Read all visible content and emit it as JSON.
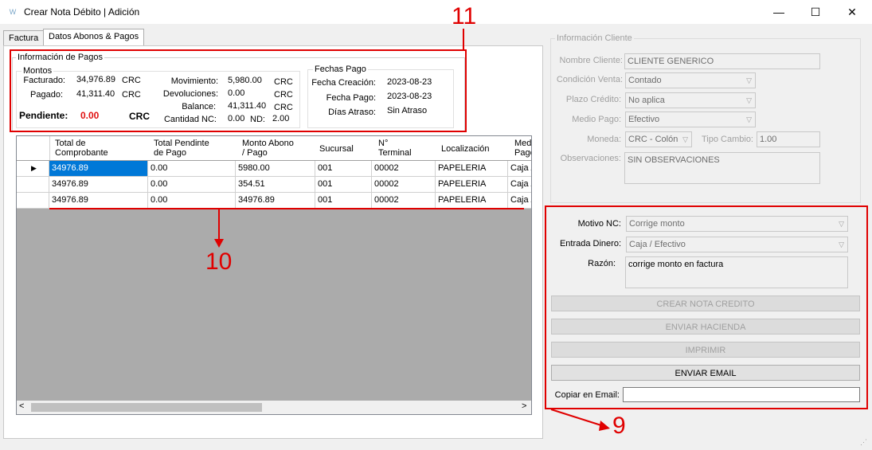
{
  "window": {
    "title": "Crear Nota Débito | Adición",
    "app_icon": "W",
    "minimize": "—",
    "maximize": "☐",
    "close": "✕"
  },
  "tabs": [
    "Factura",
    "Datos Abonos & Pagos"
  ],
  "info_pagos": {
    "title": "Información de Pagos",
    "montos": {
      "title": "Montos",
      "facturado_label": "Facturado:",
      "facturado_value": "34,976.89",
      "facturado_cur": "CRC",
      "pagado_label": "Pagado:",
      "pagado_value": "41,311.40",
      "pagado_cur": "CRC",
      "pendiente_label": "Pendiente:",
      "pendiente_value": "0.00",
      "pendiente_cur": "CRC",
      "movimiento_label": "Movimiento:",
      "movimiento_value": "5,980.00",
      "movimiento_cur": "CRC",
      "devoluciones_label": "Devoluciones:",
      "devoluciones_value": "0.00",
      "devoluciones_cur": "CRC",
      "balance_label": "Balance:",
      "balance_value": "41,311.40",
      "balance_cur": "CRC",
      "cantidad_nc_label": "Cantidad NC:",
      "cantidad_nc_value": "0.00",
      "nd_label": "ND:",
      "nd_value": "2.00"
    },
    "fechas": {
      "title": "Fechas Pago",
      "creacion_label": "Fecha Creación:",
      "creacion_value": "2023-08-23",
      "pago_label": "Fecha Pago:",
      "pago_value": "2023-08-23",
      "atraso_label": "Días Atraso:",
      "atraso_value": "Sin Atraso"
    }
  },
  "grid": {
    "headers": [
      {
        "l1": "Total de",
        "l2": "Comprobante"
      },
      {
        "l1": "Total Pendinte",
        "l2": "de Pago"
      },
      {
        "l1": "Monto Abono",
        "l2": "/ Pago"
      },
      {
        "l1": "Sucursal",
        "l2": ""
      },
      {
        "l1": "N°",
        "l2": "Terminal"
      },
      {
        "l1": "Localización",
        "l2": ""
      },
      {
        "l1": "Medi",
        "l2": "Pago"
      }
    ],
    "rows": [
      [
        "34976.89",
        "0.00",
        "5980.00",
        "001",
        "00002",
        "PAPELERIA",
        "Caja /"
      ],
      [
        "34976.89",
        "0.00",
        "354.51",
        "001",
        "00002",
        "PAPELERIA",
        "Caja /"
      ],
      [
        "34976.89",
        "0.00",
        "34976.89",
        "001",
        "00002",
        "PAPELERIA",
        "Caja /"
      ]
    ],
    "row_pointer": "▶",
    "scroll_left": "<",
    "scroll_right": ">"
  },
  "cliente": {
    "title": "Información Cliente",
    "nombre_label": "Nombre Cliente:",
    "nombre_value": "CLIENTE GENERICO",
    "condicion_label": "Condición Venta:",
    "condicion_value": "Contado",
    "plazo_label": "Plazo Crédito:",
    "plazo_value": "No aplica",
    "medio_label": "Medio Pago:",
    "medio_value": "Efectivo",
    "moneda_label": "Moneda:",
    "moneda_value": "CRC - Colón",
    "tipo_cambio_label": "Tipo Cambio:",
    "tipo_cambio_value": "1.00",
    "observaciones_label": "Observaciones:",
    "observaciones_value": "SIN OBSERVACIONES"
  },
  "nota": {
    "motivo_label": "Motivo NC:",
    "motivo_value": "Corrige monto",
    "entrada_label": "Entrada Dinero:",
    "entrada_value": "Caja / Efectivo",
    "razon_label": "Razón:",
    "razon_value": "corrige monto en factura",
    "btn_crear": "CREAR NOTA CREDITO",
    "btn_hacienda": "ENVIAR HACIENDA",
    "btn_imprimir": "IMPRIMIR",
    "btn_email": "ENVIAR EMAIL",
    "copiar_label": "Copiar en Email:",
    "copiar_value": ""
  },
  "annotations": {
    "n9": "9",
    "n10": "10",
    "n11": "11"
  },
  "colors": {
    "annotation": "#e00000",
    "pending": "#e01010",
    "selection": "#0078d7"
  }
}
